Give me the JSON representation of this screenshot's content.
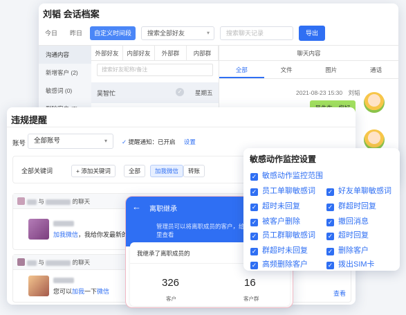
{
  "archive": {
    "title": "刘韬  会话档案",
    "toolbar": [
      "今日",
      "昨日",
      "自定义时间段"
    ],
    "friend_filter": "搜索全部好友",
    "search_placeholder": "搜索聊天记录",
    "export_label": "导出",
    "left_nav": [
      "沟通内容",
      "新增客户 (2)",
      "敏感词 (0)",
      "删除客户 (2)"
    ],
    "mid_tabs": [
      "外部好友",
      "内部好友",
      "外部群",
      "内部群"
    ],
    "mid_search_placeholder": "搜索好友昵称/备注",
    "contact": {
      "name": "吴智忙",
      "date": "星期五"
    },
    "right_header": "聊天内容",
    "right_tabs": [
      "全部",
      "文件",
      "图片",
      "通话"
    ],
    "message": {
      "time": "2021-08-23 15:30",
      "sender": "刘韬",
      "text": "吴先生，您好"
    }
  },
  "violation": {
    "title": "违规提醒",
    "account_label": "账号",
    "account_value": "全部账号",
    "notify_label": "提醒通知：",
    "notify_value": "已开启",
    "settings_link": "设置",
    "keywords": {
      "label": "全部关键词",
      "add": "添加关键词",
      "all": "全部",
      "wechat": "加我微信",
      "transfer": "转账"
    },
    "chats": [
      {
        "with_text": "与",
        "suffix": "的聊天",
        "pre": "",
        "link": "加我微信",
        "rest": "，我给你发最新的活"
      },
      {
        "with_text": "与",
        "suffix": "的聊天",
        "pre": "您可以",
        "link": "加我",
        "rest": "一下",
        "link2": "微信"
      }
    ],
    "view_label": "查看"
  },
  "resign": {
    "title": "离职继承",
    "desc": "管理员可以将离职成员的客户，给你。你可以在这里查看",
    "inherited": "我继承了离职成员的",
    "customers": "326",
    "customers_label": "客户",
    "groups": "16",
    "groups_label": "客户群"
  },
  "sensitive": {
    "title": "敏感动作监控设置",
    "items": [
      "敏感动作监控范围",
      "员工单聊敏感词",
      "好友单聊敏感词",
      "超时未回复",
      "群超时回复",
      "被客户删除",
      "撤回消息",
      "员工群聊敏感词",
      "超时回复",
      "群超时未回复",
      "删除客户",
      "高频删除客户",
      "拨出SIM卡"
    ]
  }
}
